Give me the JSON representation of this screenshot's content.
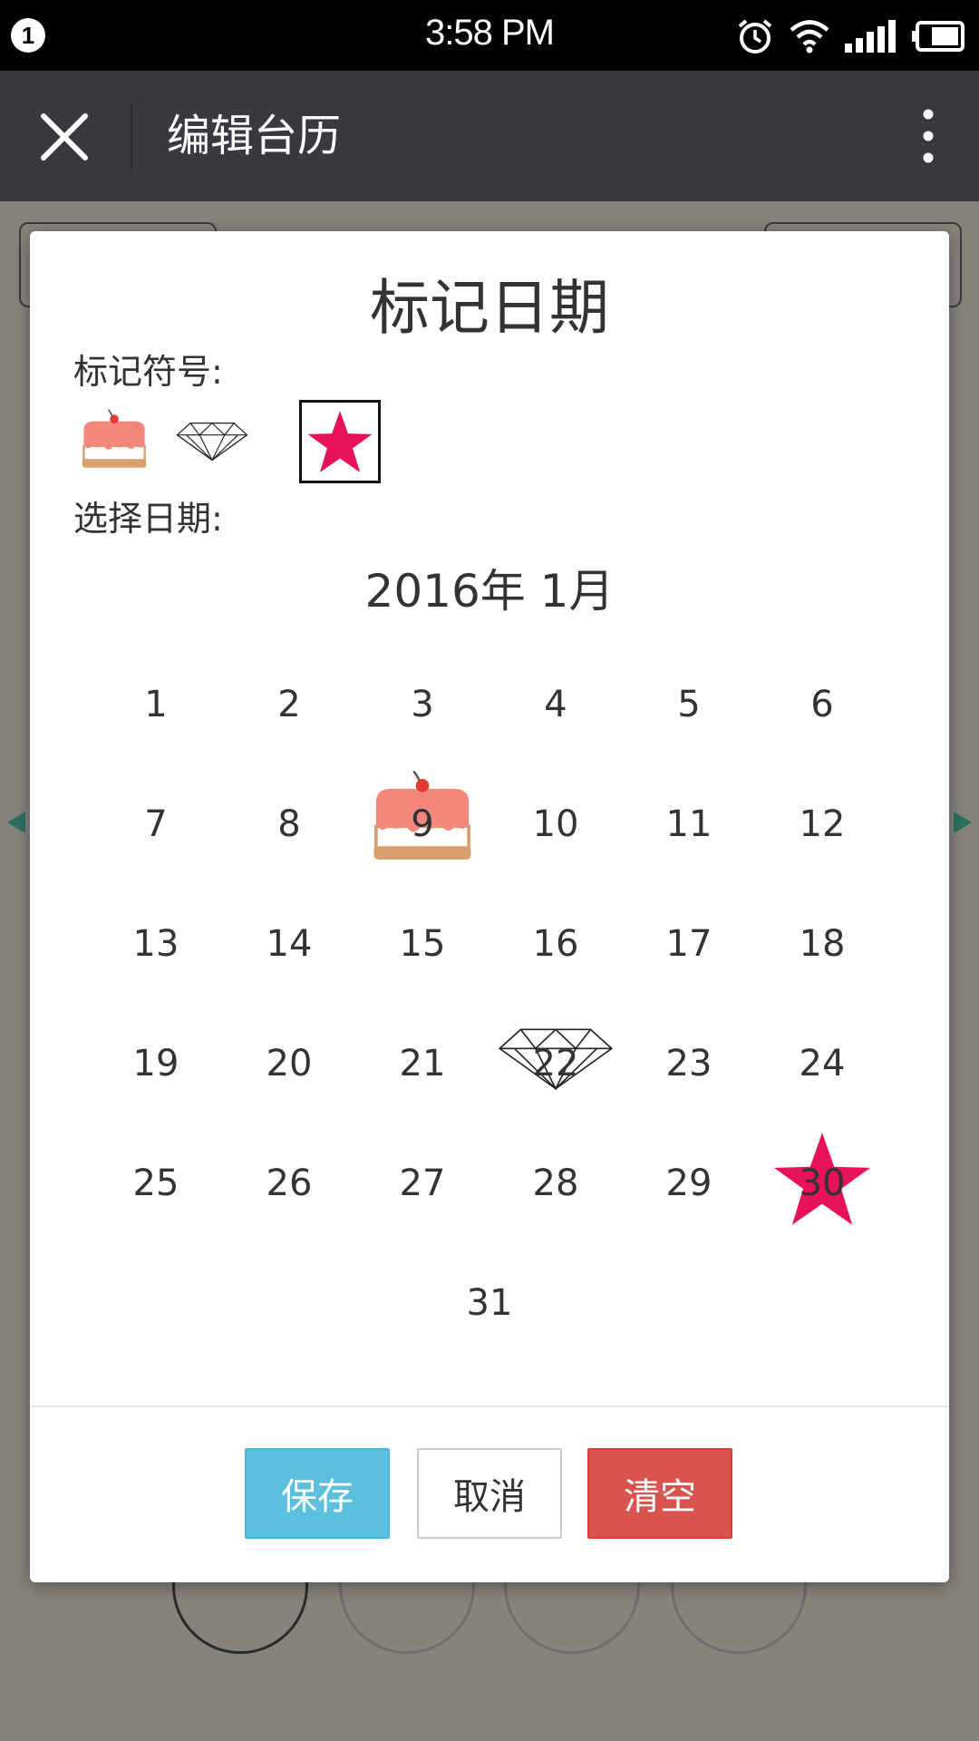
{
  "status_bar": {
    "notification_count": "1",
    "time": "3:58 PM",
    "icons": [
      "alarm-icon",
      "wifi-icon",
      "signal-icon",
      "battery-icon"
    ]
  },
  "app_bar": {
    "title": "编辑台历",
    "close_icon": "close-icon",
    "more_icon": "more-vertical-icon"
  },
  "dialog": {
    "title": "标记日期",
    "symbol_label": "标记符号:",
    "symbols": [
      {
        "name": "cake",
        "selected": false
      },
      {
        "name": "diamond",
        "selected": false
      },
      {
        "name": "star",
        "selected": true
      }
    ],
    "date_label": "选择日期:",
    "month_label": "2016年 1月",
    "days": [
      {
        "d": "1"
      },
      {
        "d": "2"
      },
      {
        "d": "3"
      },
      {
        "d": "4"
      },
      {
        "d": "5"
      },
      {
        "d": "6"
      },
      {
        "d": "7"
      },
      {
        "d": "8"
      },
      {
        "d": "9",
        "mark": "cake"
      },
      {
        "d": "10"
      },
      {
        "d": "11"
      },
      {
        "d": "12"
      },
      {
        "d": "13"
      },
      {
        "d": "14"
      },
      {
        "d": "15"
      },
      {
        "d": "16"
      },
      {
        "d": "17"
      },
      {
        "d": "18"
      },
      {
        "d": "19"
      },
      {
        "d": "20"
      },
      {
        "d": "21"
      },
      {
        "d": "22",
        "mark": "diamond"
      },
      {
        "d": "23"
      },
      {
        "d": "24"
      },
      {
        "d": "25"
      },
      {
        "d": "26"
      },
      {
        "d": "27"
      },
      {
        "d": "28"
      },
      {
        "d": "29"
      },
      {
        "d": "30",
        "mark": "star"
      },
      {
        "d": "31"
      }
    ],
    "buttons": {
      "save": "保存",
      "cancel": "取消",
      "clear": "清空"
    }
  },
  "colors": {
    "save": "#5bc0de",
    "clear": "#d9534f",
    "star": "#e8115b",
    "cake_top": "#f4877b",
    "cake_base": "#d9a06b",
    "app_bar": "#393a3f"
  }
}
